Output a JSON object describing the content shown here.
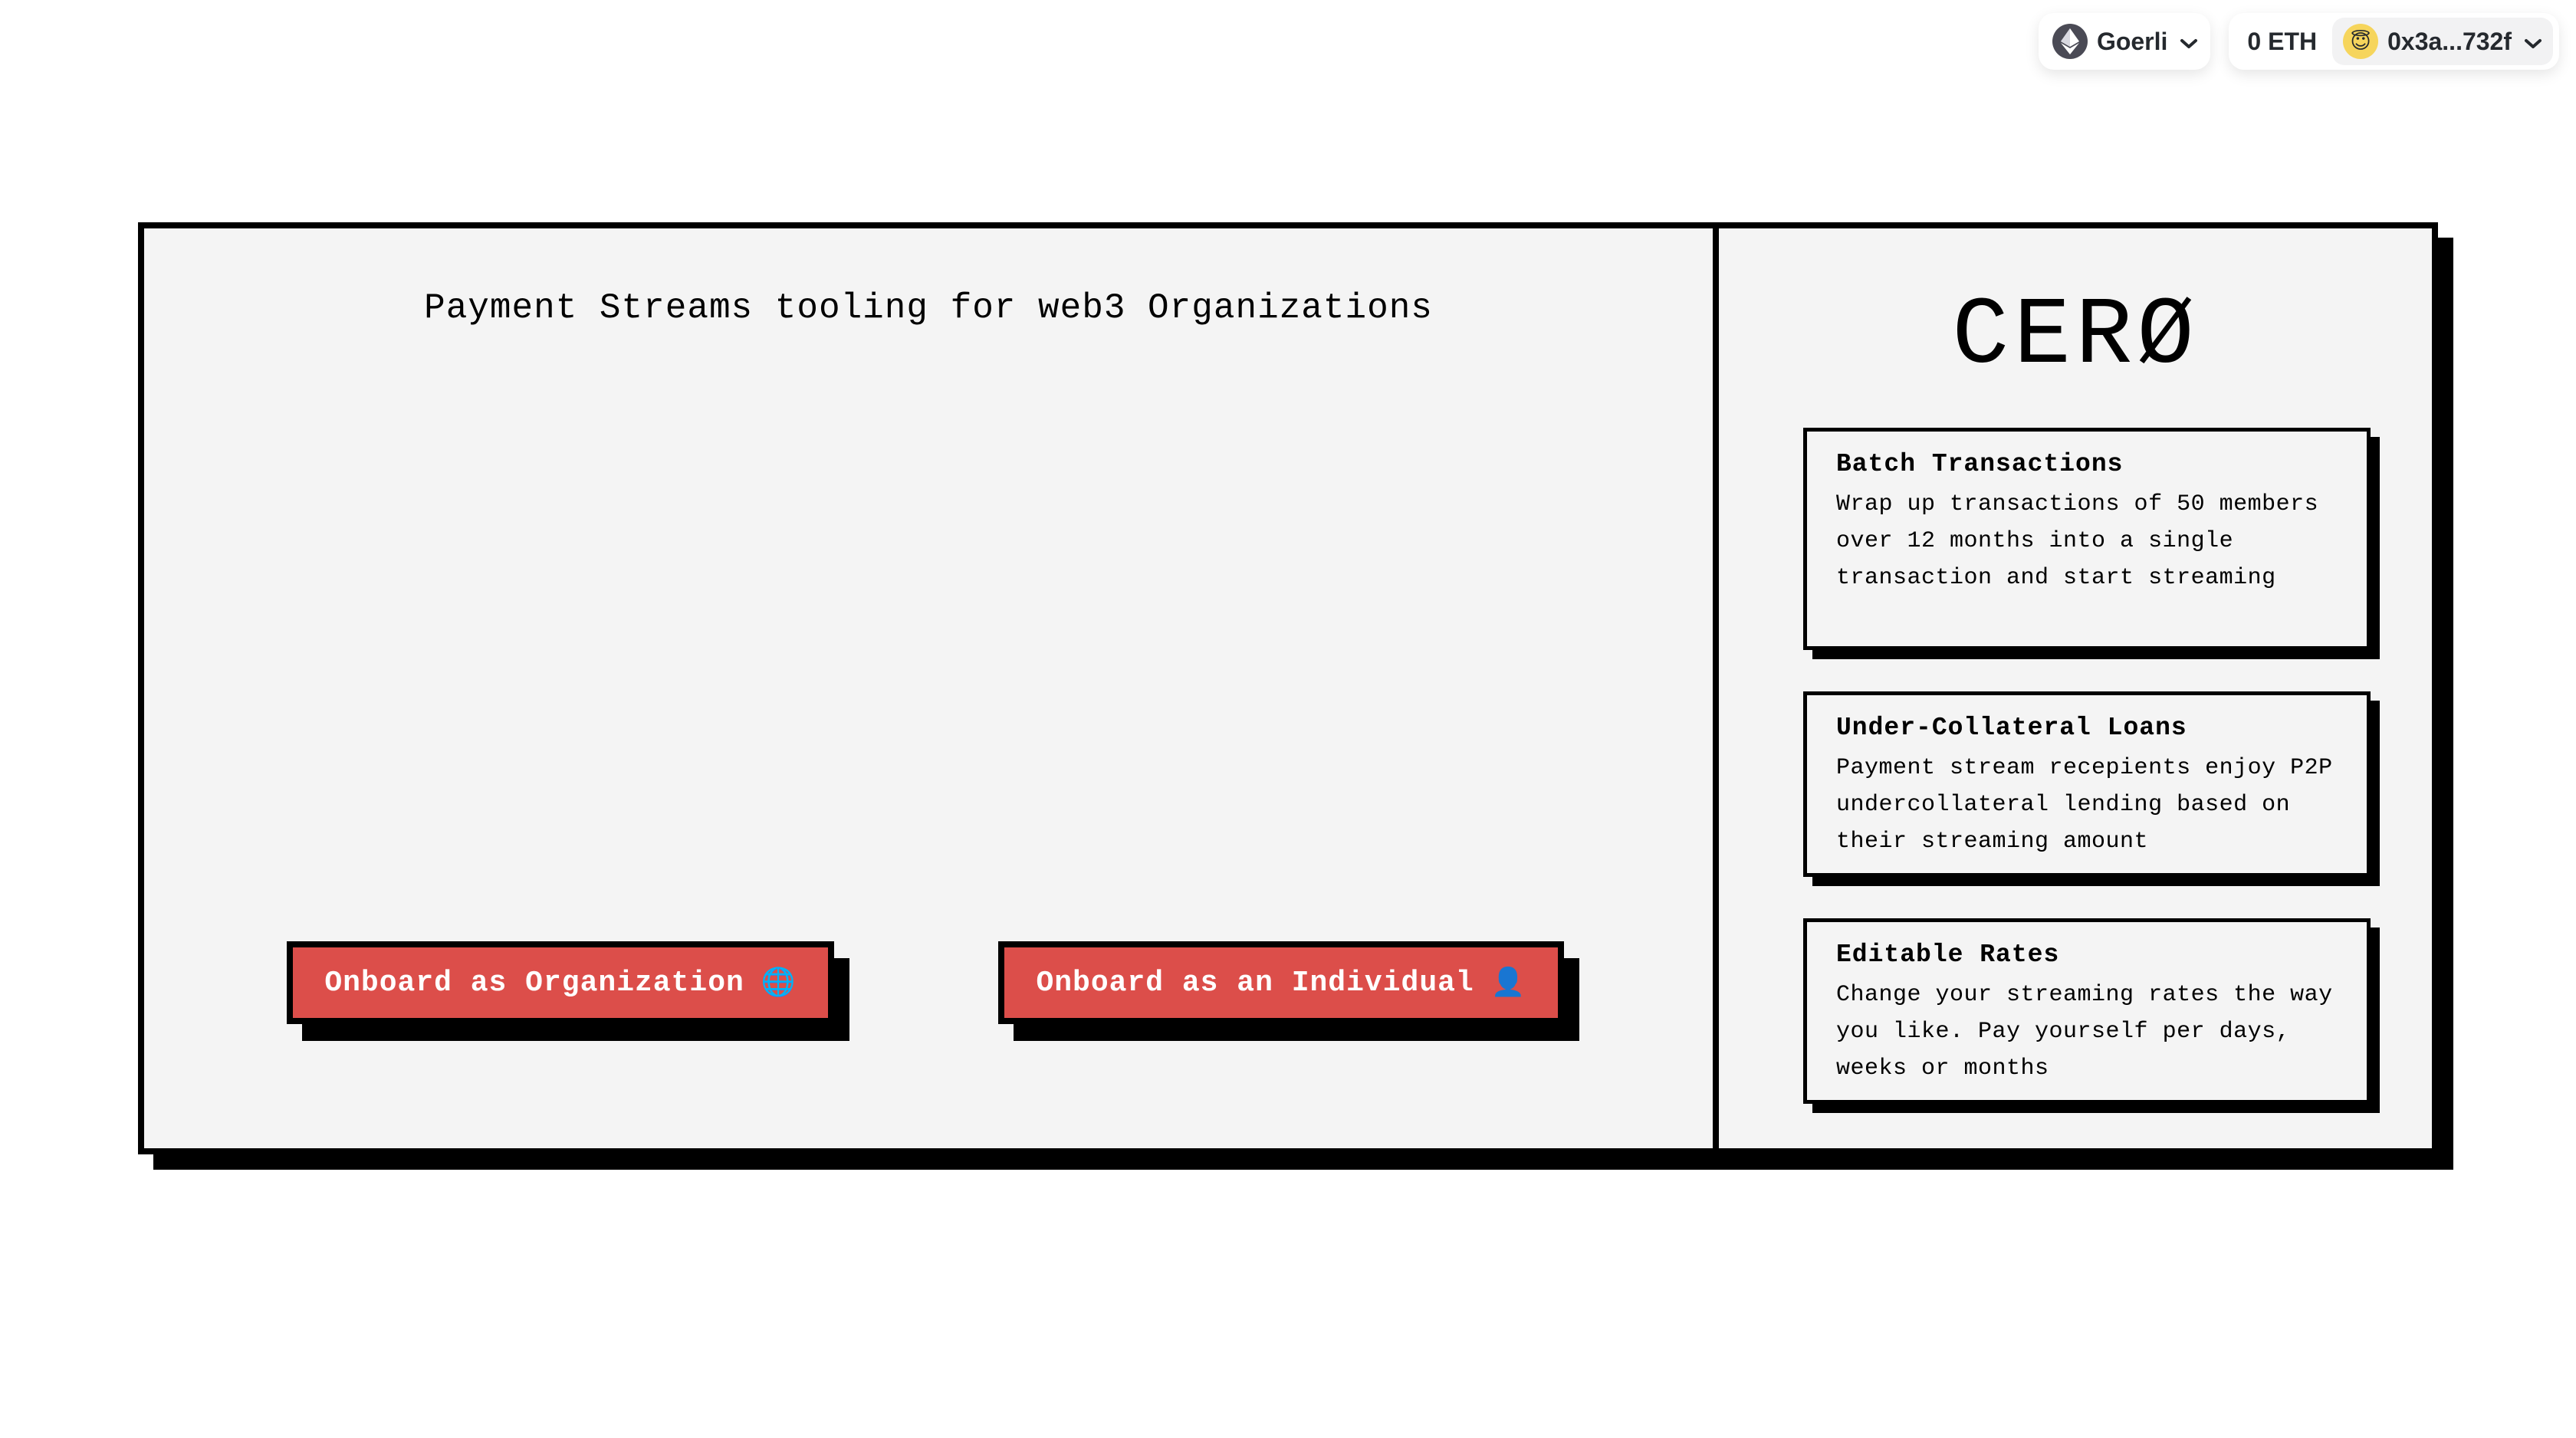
{
  "header": {
    "network": {
      "name": "Goerli",
      "icon": "ethereum-icon"
    },
    "account": {
      "balance": "0 ETH",
      "address": "0x3a...732f",
      "avatar_emoji": "😇"
    }
  },
  "main": {
    "tagline": "Payment Streams tooling for web3 Organizations",
    "buttons": {
      "organization": {
        "label": "Onboard as Organization",
        "icon": "🌐"
      },
      "individual": {
        "label": "Onboard as an Individual",
        "icon": "👤"
      }
    }
  },
  "side": {
    "logo": "CERØ",
    "features": [
      {
        "title": "Batch Transactions",
        "description": "Wrap up transactions of 50 members over 12 months into a single transaction and start streaming"
      },
      {
        "title": "Under-Collateral Loans",
        "description": "Payment stream recepients enjoy P2P undercollateral lending based on their streaming amount"
      },
      {
        "title": "Editable Rates",
        "description": "Change your streaming rates the way you like. Pay yourself per days, weeks or months"
      }
    ]
  },
  "colors": {
    "accent": "#dc4e4a",
    "panel": "#f4f4f4",
    "border": "#000000"
  }
}
